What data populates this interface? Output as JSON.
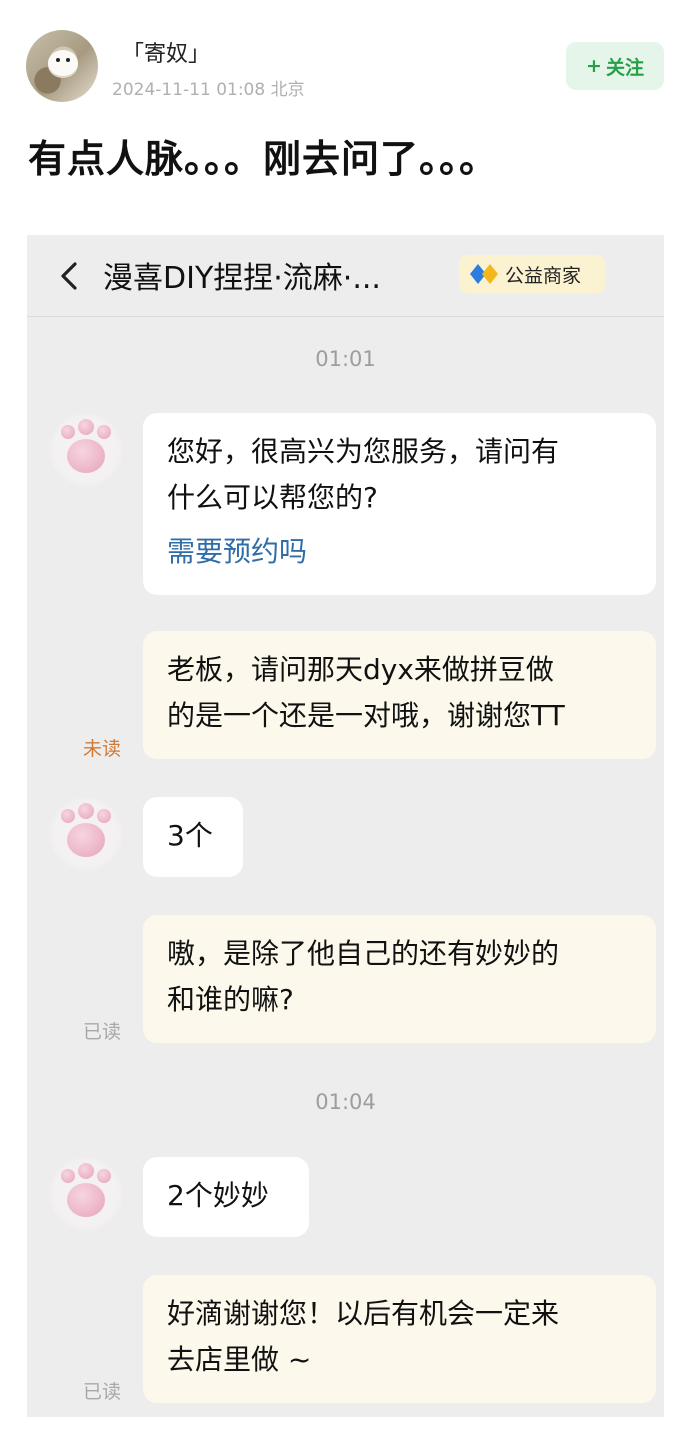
{
  "post": {
    "author": "「寄奴」",
    "meta": "2024-11-11 01:08  北京",
    "follow_label": "关注",
    "text": "有点人脉。。。刚去问了。。。"
  },
  "chat": {
    "title": "漫喜DIY捏捏·流麻·...",
    "badge_label": "公益商家",
    "time_1": "01:01",
    "time_2": "01:04",
    "messages": [
      {
        "line1": "您好，很高兴为您服务，请问有",
        "line2": "什么可以帮您的?",
        "link": "需要预约吗"
      },
      {
        "line1": "老板，请问那天dyx来做拼豆做",
        "line2": "的是一个还是一对哦，谢谢您TT",
        "status": "未读"
      },
      {
        "text": "3个"
      },
      {
        "line1": "嗷，是除了他自己的还有妙妙的",
        "line2": "和谁的嘛?",
        "status": "已读"
      },
      {
        "text": "2个妙妙"
      },
      {
        "line1": "好滴谢谢您！以后有机会一定来",
        "line2": "去店里做 ~",
        "status": "已读"
      }
    ]
  },
  "colors": {
    "accent_green": "#24a046",
    "link_blue": "#2f6ca8",
    "unread_orange": "#d07a36"
  },
  "icons": [
    "plus-icon",
    "back-chevron-icon",
    "diamond-badge-icon"
  ]
}
